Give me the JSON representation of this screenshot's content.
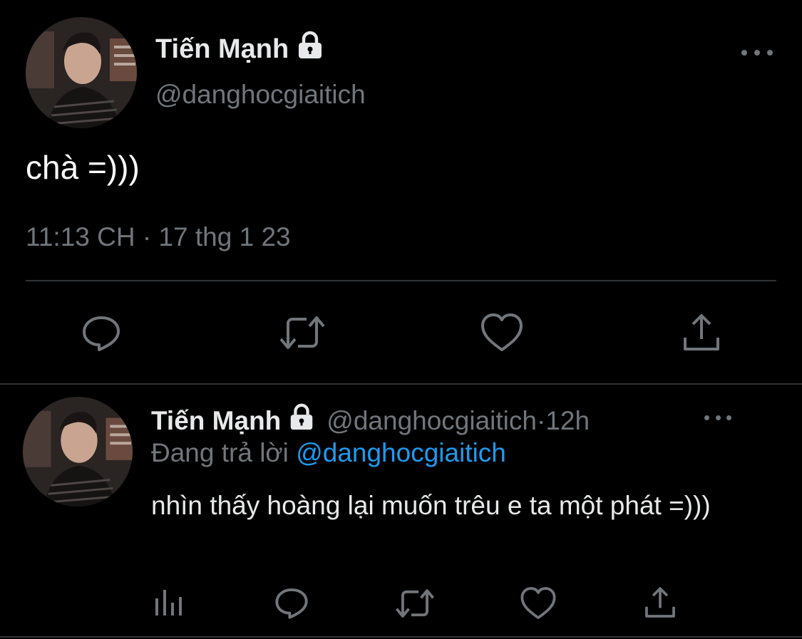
{
  "main_tweet": {
    "display_name": "Tiến Mạnh",
    "handle": "@danghocgiaitich",
    "text": "chà =)))",
    "time": "11:13 CH",
    "date": "17 thg 1 23",
    "meta_separator": " · ",
    "icons": [
      "lock-icon",
      "more-icon",
      "reply-icon",
      "retweet-icon",
      "like-icon",
      "share-icon"
    ]
  },
  "reply_tweet": {
    "display_name": "Tiến Mạnh",
    "handle": "@danghocgiaitich",
    "separator": " · ",
    "time_ago": "12h",
    "replying_to_label": "Đang trả lời",
    "replying_to_handle": "@danghocgiaitich",
    "text": "nhìn thấy hoàng lại muốn trêu e ta một phát =)))",
    "icons": [
      "lock-icon",
      "more-icon",
      "analytics-icon",
      "reply-icon",
      "retweet-icon",
      "like-icon",
      "share-icon"
    ]
  },
  "colors": {
    "background": "#000000",
    "primary_text": "#e7e9ea",
    "secondary_text": "#71767b",
    "link": "#1d9bf0",
    "divider": "#2f3336"
  }
}
